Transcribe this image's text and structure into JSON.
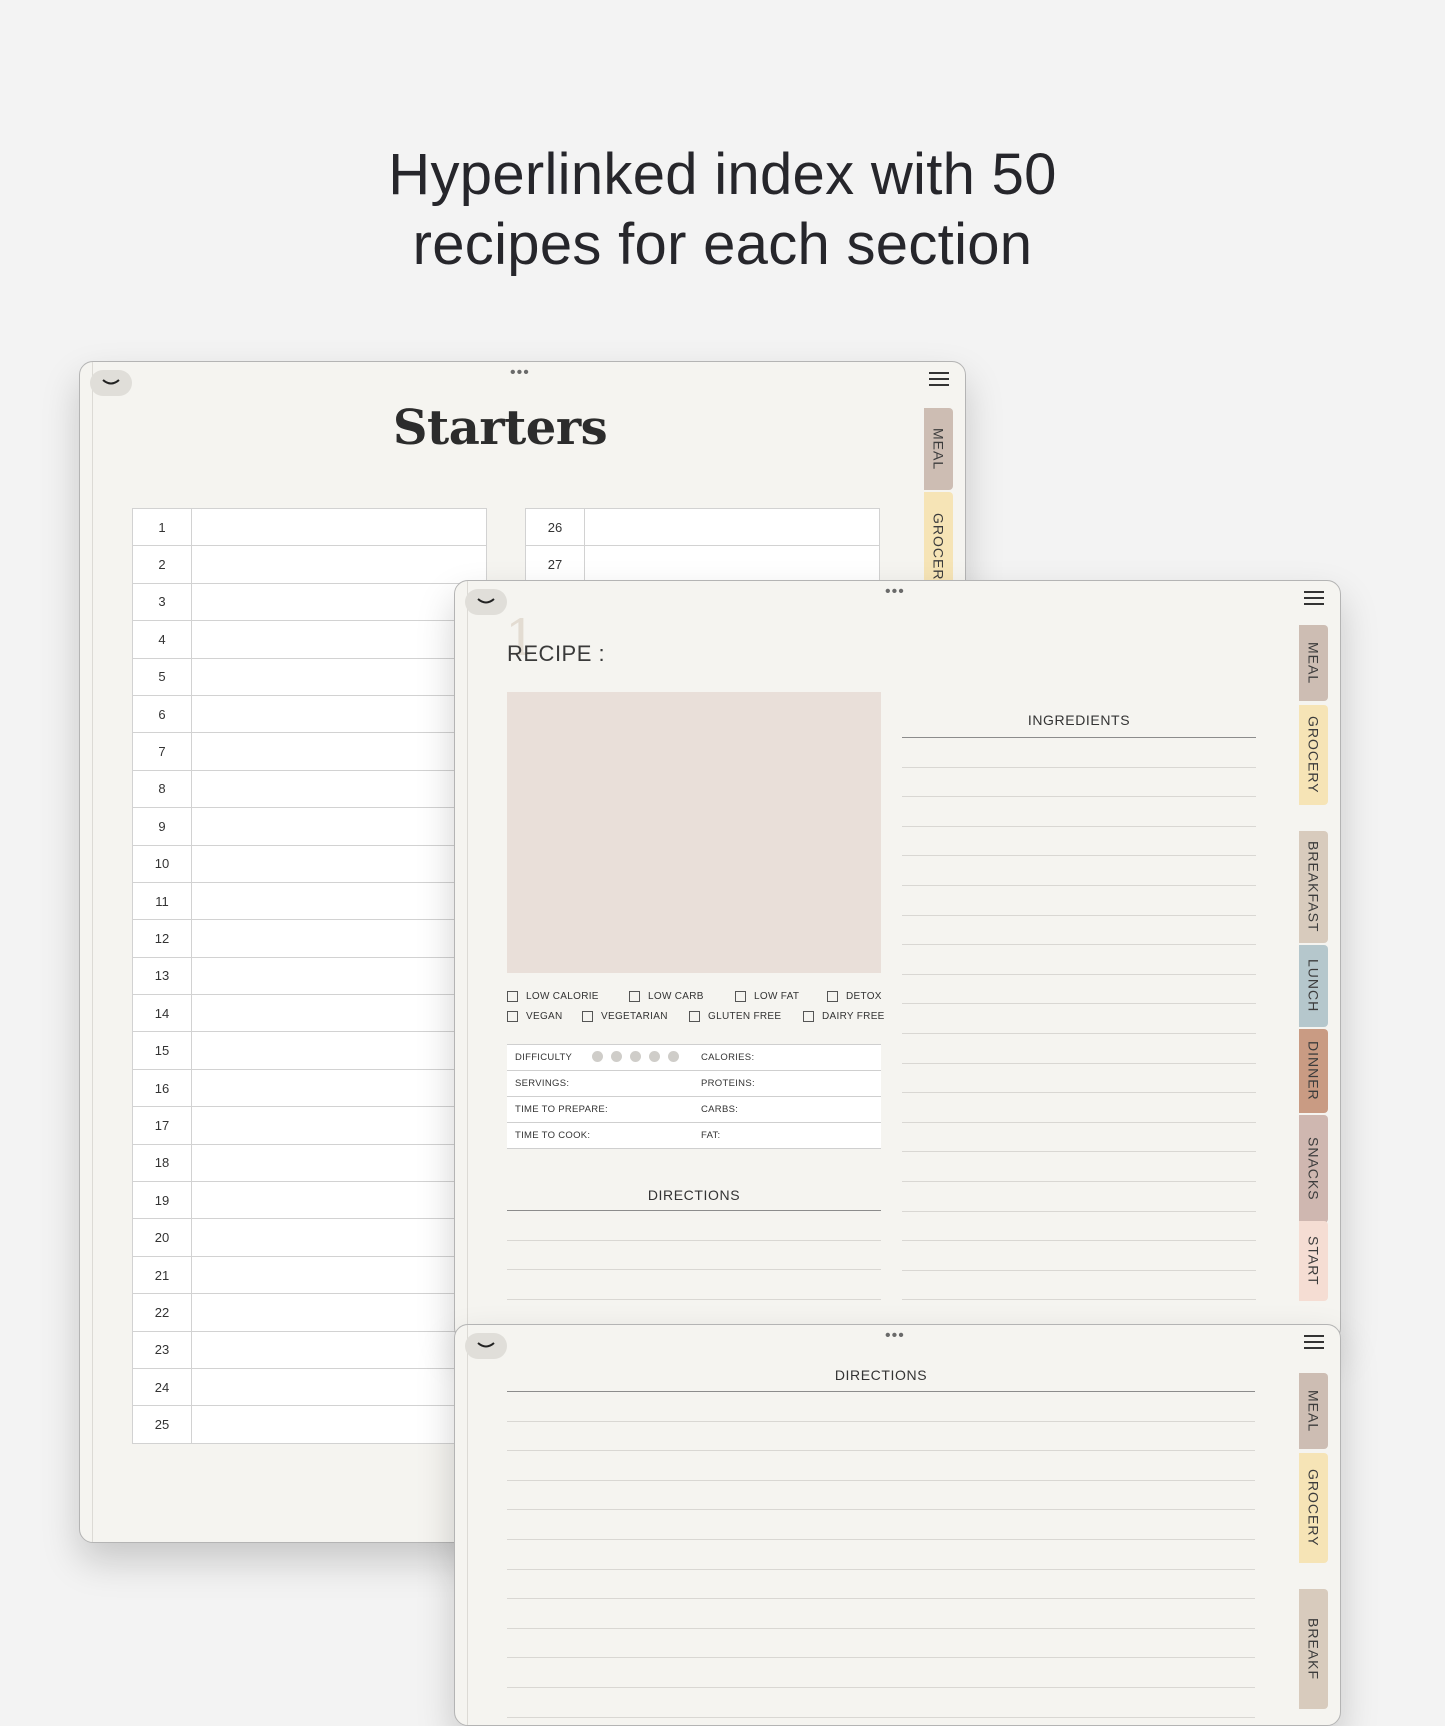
{
  "headline": {
    "line1": "Hyperlinked index with 50",
    "line2": "recipes for each section"
  },
  "starters": {
    "title": "Starters",
    "tabs": [
      "MEAL",
      "GROCERY"
    ],
    "left_numbers": [
      "1",
      "2",
      "3",
      "4",
      "5",
      "6",
      "7",
      "8",
      "9",
      "10",
      "11",
      "12",
      "13",
      "14",
      "15",
      "16",
      "17",
      "18",
      "19",
      "20",
      "21",
      "22",
      "23",
      "24",
      "25"
    ],
    "right_numbers": [
      "26",
      "27"
    ]
  },
  "recipe": {
    "num": "1",
    "label": "RECIPE :",
    "ingredients_title": "INGREDIENTS",
    "directions_title": "DIRECTIONS",
    "checks_row1": [
      "LOW CALORIE",
      "LOW CARB",
      "LOW FAT",
      "DETOX"
    ],
    "checks_row2": [
      "VEGAN",
      "VEGETARIAN",
      "GLUTEN FREE",
      "DAIRY FREE"
    ],
    "left_info": [
      "DIFFICULTY",
      "SERVINGS:",
      "TIME TO PREPARE:",
      "TIME TO COOK:"
    ],
    "right_info": [
      "CALORIES:",
      "PROTEINS:",
      "CARBS:",
      "FAT:"
    ],
    "tabs": [
      {
        "label": "MEAL",
        "color": "#cdbdb3"
      },
      {
        "label": "GROCERY",
        "color": "#f6e4b6"
      },
      {
        "label": "BREAKFAST",
        "color": "#d8cbbd"
      },
      {
        "label": "LUNCH",
        "color": "#b5c7cc"
      },
      {
        "label": "DINNER",
        "color": "#c99b83"
      },
      {
        "label": "SNACKS",
        "color": "#cfb7b0"
      },
      {
        "label": "START",
        "color": "#f5ddd3"
      }
    ]
  },
  "directions_page": {
    "title": "DIRECTIONS",
    "tabs": [
      "MEAL",
      "GROCERY",
      "BREAKF"
    ]
  }
}
